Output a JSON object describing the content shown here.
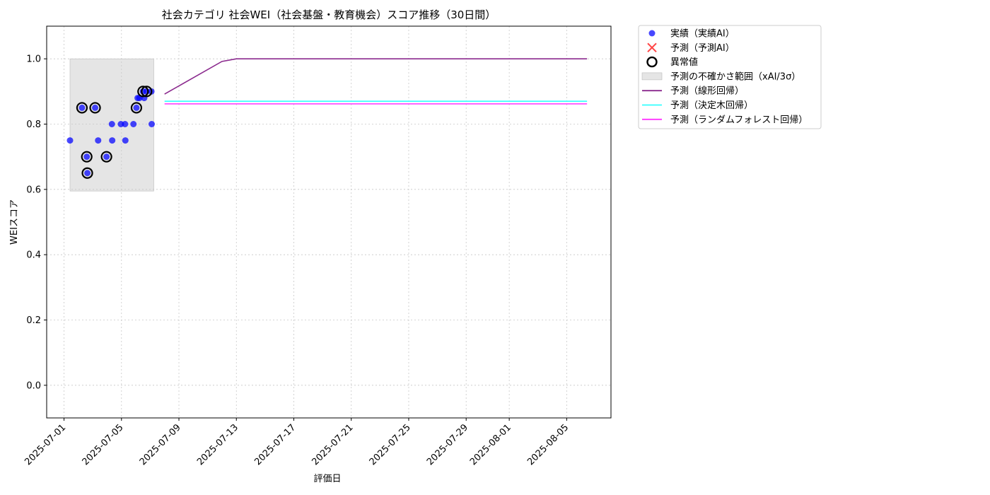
{
  "chart_data": {
    "type": "scatter",
    "title": "社会カテゴリ 社会WEI（社会基盤・教育機会）スコア推移（30日間）",
    "xlabel": "評価日",
    "ylabel": "WEIスコア",
    "xlim": [
      "2025-06-29T19:00",
      "2025-08-08T02:00"
    ],
    "ylim": [
      -0.1,
      1.1
    ],
    "yticks": [
      "0.0",
      "0.2",
      "0.4",
      "0.6",
      "0.8",
      "1.0"
    ],
    "xticks": [
      "2025-07-01",
      "2025-07-05",
      "2025-07-09",
      "2025-07-13",
      "2025-07-17",
      "2025-07-21",
      "2025-07-25",
      "2025-07-29",
      "2025-08-01",
      "2025-08-05"
    ],
    "grid": true,
    "legend_position": "outside-upper-right",
    "uncertainty_band": {
      "x_start": "2025-07-01T10:00",
      "x_end": "2025-07-07T06:00",
      "y_low": 0.595,
      "y_high": 1.0,
      "color": "#e5e5e5"
    },
    "series": [
      {
        "name": "実績（実績AI）",
        "kind": "scatter",
        "color": "#0000ff",
        "points": [
          [
            "2025-07-01T10:00",
            0.75
          ],
          [
            "2025-07-02T06:00",
            0.85
          ],
          [
            "2025-07-02T14:00",
            0.7
          ],
          [
            "2025-07-02T15:00",
            0.65
          ],
          [
            "2025-07-03T04:00",
            0.85
          ],
          [
            "2025-07-03T09:00",
            0.75
          ],
          [
            "2025-07-03T23:00",
            0.7
          ],
          [
            "2025-07-04T08:00",
            0.8
          ],
          [
            "2025-07-04T08:30",
            0.75
          ],
          [
            "2025-07-04T23:00",
            0.8
          ],
          [
            "2025-07-05T06:00",
            0.8
          ],
          [
            "2025-07-05T06:30",
            0.75
          ],
          [
            "2025-07-05T20:00",
            0.8
          ],
          [
            "2025-07-06T01:00",
            0.85
          ],
          [
            "2025-07-06T03:00",
            0.88
          ],
          [
            "2025-07-06T06:00",
            0.88
          ],
          [
            "2025-07-06T12:00",
            0.9
          ],
          [
            "2025-07-06T14:00",
            0.88
          ],
          [
            "2025-07-06T18:00",
            0.9
          ],
          [
            "2025-07-07T02:00",
            0.9
          ],
          [
            "2025-07-07T02:30",
            0.8
          ]
        ]
      },
      {
        "name": "予測（予測AI）",
        "kind": "x-marker",
        "color": "#ff4444",
        "points": []
      },
      {
        "name": "異常値",
        "kind": "ring",
        "color": "#000000",
        "points": [
          [
            "2025-07-02T06:00",
            0.85
          ],
          [
            "2025-07-02T14:00",
            0.7
          ],
          [
            "2025-07-02T15:00",
            0.65
          ],
          [
            "2025-07-03T04:00",
            0.85
          ],
          [
            "2025-07-03T23:00",
            0.7
          ],
          [
            "2025-07-06T01:00",
            0.85
          ],
          [
            "2025-07-06T12:00",
            0.9
          ],
          [
            "2025-07-06T18:00",
            0.9
          ]
        ]
      },
      {
        "name": "予測の不確かさ範囲（xAI/3σ）",
        "kind": "band",
        "color": "#e5e5e5"
      },
      {
        "name": "予測（線形回帰）",
        "kind": "line",
        "color": "#8b2a8e",
        "points": [
          [
            "2025-07-08T00:00",
            0.892
          ],
          [
            "2025-07-12T00:00",
            0.992
          ],
          [
            "2025-07-13T00:00",
            1.0
          ],
          [
            "2025-08-06T10:00",
            1.0
          ]
        ]
      },
      {
        "name": "予測（決定木回帰）",
        "kind": "line",
        "color": "#33ffff",
        "points": [
          [
            "2025-07-08T00:00",
            0.87
          ],
          [
            "2025-08-06T10:00",
            0.87
          ]
        ]
      },
      {
        "name": "予測（ランダムフォレスト回帰）",
        "kind": "line",
        "color": "#ff33ff",
        "points": [
          [
            "2025-07-08T00:00",
            0.862
          ],
          [
            "2025-08-06T10:00",
            0.862
          ]
        ]
      }
    ]
  }
}
